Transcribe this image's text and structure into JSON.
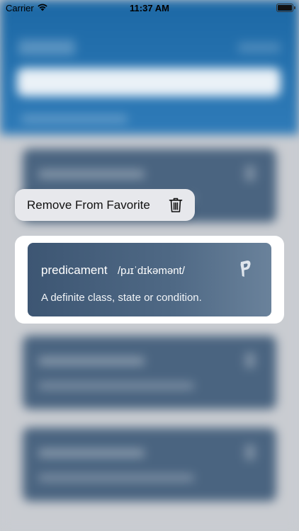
{
  "status_bar": {
    "carrier": "Carrier",
    "time": "11:37 AM",
    "wifi_icon": "wifi-icon",
    "battery_icon": "battery-icon"
  },
  "context_menu": {
    "label": "Remove From Favorite",
    "icon": "trash-icon"
  },
  "card": {
    "word": "predicament",
    "phonetic": "/pɹɪˈdɪkəmənt/",
    "definition": "A definite class, state or condition.",
    "icon": "pin-icon"
  },
  "colors": {
    "header_blue": "#1c68a5",
    "card_blue": "#4a6480",
    "menu_bg": "#e7e8ec"
  }
}
